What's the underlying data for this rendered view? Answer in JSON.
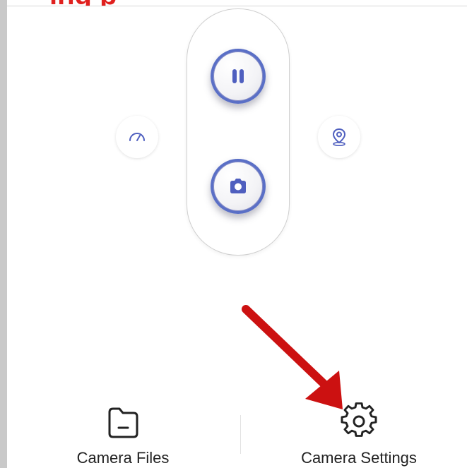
{
  "caption": {
    "text": "ing                                                  p",
    "color": "#e0201e"
  },
  "controls": {
    "pause_icon": "pause-icon",
    "shutter_icon": "camera-icon",
    "speed_icon": "speedometer-icon",
    "location_icon": "location-pin-icon",
    "accent_color": "#4f5fbf"
  },
  "annotation": {
    "arrow_color": "#cc1111"
  },
  "bottom_nav": {
    "items": [
      {
        "label": "Camera Files",
        "icon": "folder-icon"
      },
      {
        "label": "Camera Settings",
        "icon": "gear-icon"
      }
    ]
  }
}
